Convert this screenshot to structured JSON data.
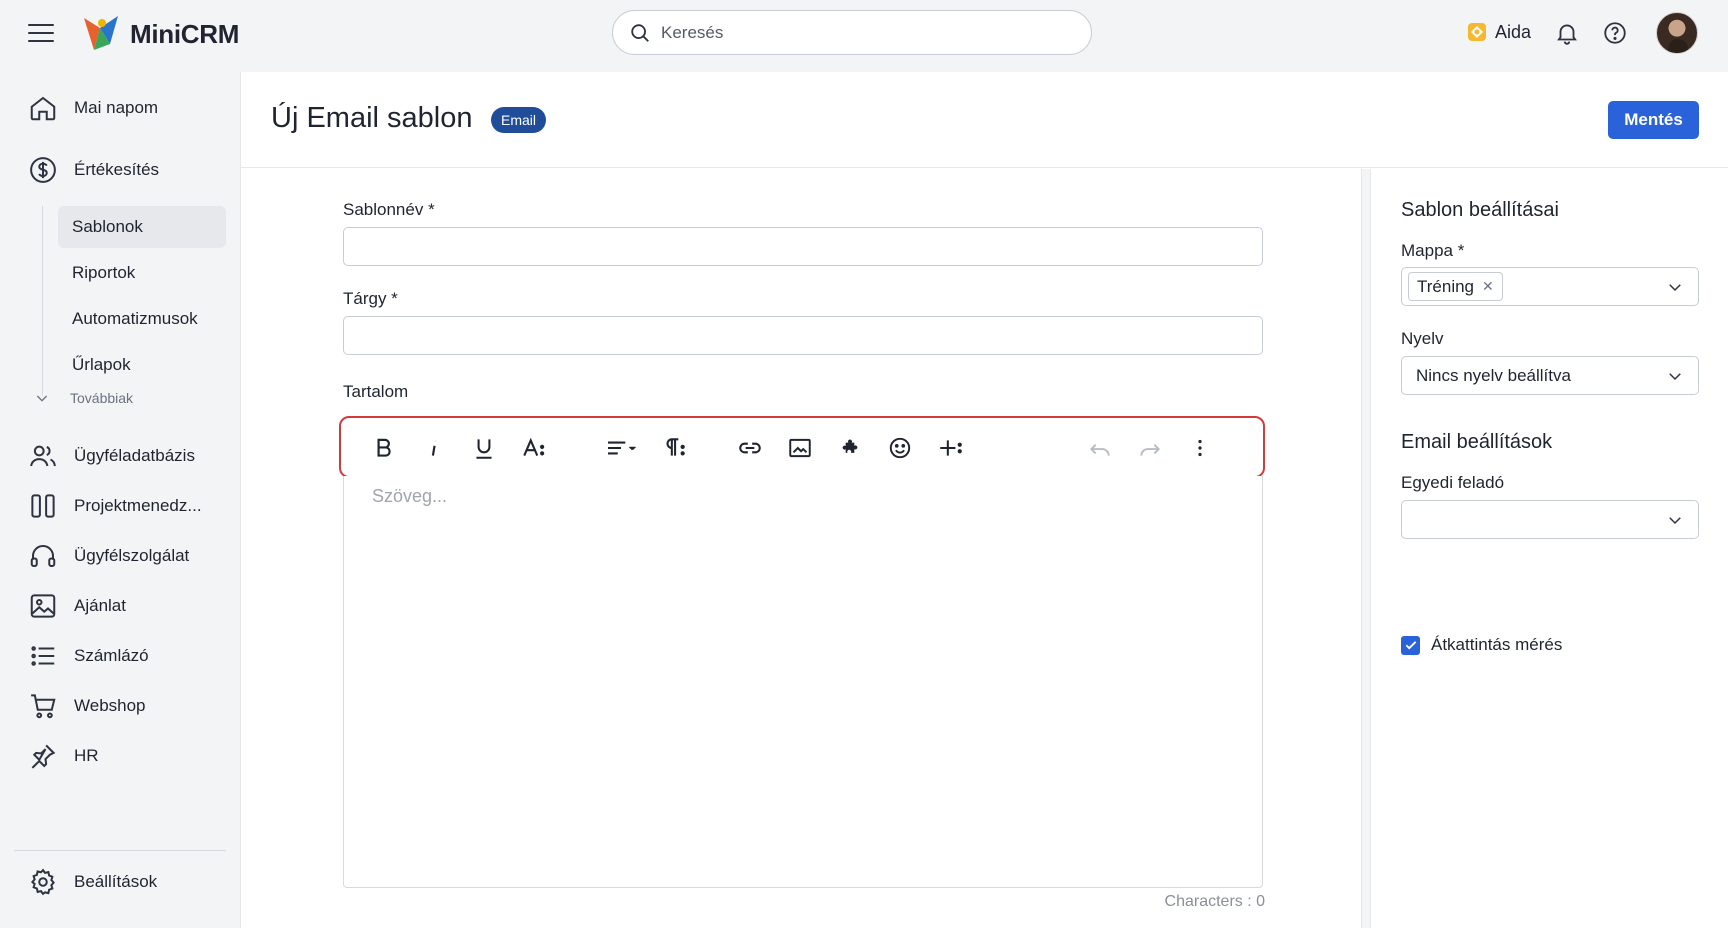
{
  "app": {
    "name": "MiniCRM"
  },
  "search": {
    "placeholder": "Keresés"
  },
  "topbar": {
    "aida_label": "Aida"
  },
  "sidebar": {
    "items": [
      {
        "label": "Mai napom",
        "icon": "home-icon"
      },
      {
        "label": "Értékesítés",
        "icon": "dollar-icon"
      },
      {
        "label": "Ügyféladatbázis",
        "icon": "users-icon"
      },
      {
        "label": "Projektmenedz...",
        "icon": "columns-icon"
      },
      {
        "label": "Ügyfélszolgálat",
        "icon": "headphones-icon"
      },
      {
        "label": "Ajánlat",
        "icon": "image-icon"
      },
      {
        "label": "Számlázó",
        "icon": "list-icon"
      },
      {
        "label": "Webshop",
        "icon": "cart-icon"
      },
      {
        "label": "HR",
        "icon": "pin-icon"
      }
    ],
    "sub_items": [
      {
        "label": "Sablonok",
        "active": true
      },
      {
        "label": "Riportok",
        "active": false
      },
      {
        "label": "Automatizmusok",
        "active": false
      },
      {
        "label": "Űrlapok",
        "active": false
      }
    ],
    "more_label": "Továbbiak",
    "settings_label": "Beállítások"
  },
  "page": {
    "title": "Új Email sablon",
    "badge": "Email",
    "save_label": "Mentés"
  },
  "form": {
    "name_label": "Sablonnév *",
    "name_value": "",
    "subject_label": "Tárgy *",
    "subject_value": "",
    "content_label": "Tartalom",
    "editor_placeholder": "Szöveg...",
    "char_count": "Characters : 0"
  },
  "toolbar": {
    "buttons": [
      "bold-icon",
      "italic-icon",
      "underline-icon",
      "text-style-icon",
      "align-icon",
      "paragraph-icon",
      "link-icon",
      "insert-image-icon",
      "puzzle-icon",
      "emoji-icon",
      "insert-more-icon",
      "undo-icon",
      "redo-icon",
      "more-vertical-icon"
    ]
  },
  "settings": {
    "template_title": "Sablon beállításai",
    "folder_label": "Mappa *",
    "folder_chip": "Tréning",
    "language_label": "Nyelv",
    "language_value": "Nincs nyelv beállítva",
    "email_title": "Email beállítások",
    "sender_label": "Egyedi feladó",
    "sender_value": "",
    "tracking_label": "Átkattintás mérés",
    "tracking_checked": true
  },
  "colors": {
    "primary": "#2962d9",
    "badge": "#1f4d99",
    "highlight": "#d43a3a"
  }
}
